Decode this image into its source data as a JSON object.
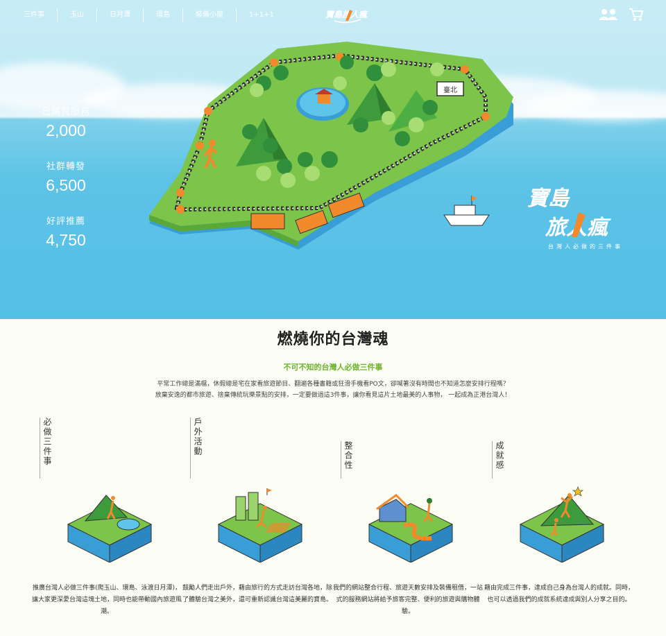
{
  "nav": {
    "items": [
      "三件事",
      "玉山",
      "日月潭",
      "環島",
      "裝備小屋",
      "1+1+1"
    ]
  },
  "header": {
    "logo_text": "寶島旅人瘋",
    "member_icon": "members-icon",
    "cart_icon": "cart-icon"
  },
  "stats": [
    {
      "label": "已購買服務",
      "value": "2,000"
    },
    {
      "label": "社群轉發",
      "value": "6,500"
    },
    {
      "label": "好評推薦",
      "value": "4,750"
    }
  ],
  "map": {
    "station_label": "臺北"
  },
  "brand": {
    "line1": "寶島",
    "line2": "旅人瘋",
    "subtitle": "台灣人必做的三件事"
  },
  "section": {
    "title": "燃燒你的台灣魂",
    "subtitle": "不可不知的台灣人必做三件事",
    "intro_line1": "平常工作總是滿檔，休假總是宅在家看旅遊節目、翻遍各種書籍或狂滑手機看PO文，卻喊著沒有時間也不知道怎麼安排行程嗎？",
    "intro_line2": "放棄安逸的都市旅遊、捨棄傳統玩樂景點的安排，一定要做過這3件事，讓你看見這片土地最美的人事物， 一起成為正港台灣人！"
  },
  "features": [
    {
      "heading": "必做三件事",
      "text": "推廣台灣人必做三件事(爬玉山、環島、泳渡日月潭)，讓大家更深愛台灣這塊土地，同時也能帶動國內旅遊風潮。"
    },
    {
      "heading": "戶外活動",
      "text": "鼓勵人們走出戶外，藉由旅行的方式走訪台灣各地，除了體驗台灣之美外，還可重新認識台灣這美麗的寶島。"
    },
    {
      "heading": "整合性",
      "text": "我們的網站整合行程、旅遊天數安排及裝備租借，一站式的服務網站將給予旅客完整、便利的旅遊與購物體驗。"
    },
    {
      "heading": "成就感",
      "text": "藉由完成三件事，達成自己身為台灣人的成就。同時，也可以透過我們的成就系統達成與別人分享之目的。"
    }
  ],
  "colors": {
    "sky": "#bfe9f4",
    "sea": "#55c0e6",
    "accent_green": "#6db32e",
    "orange": "#f08a2c",
    "background": "#fbfdf4"
  }
}
